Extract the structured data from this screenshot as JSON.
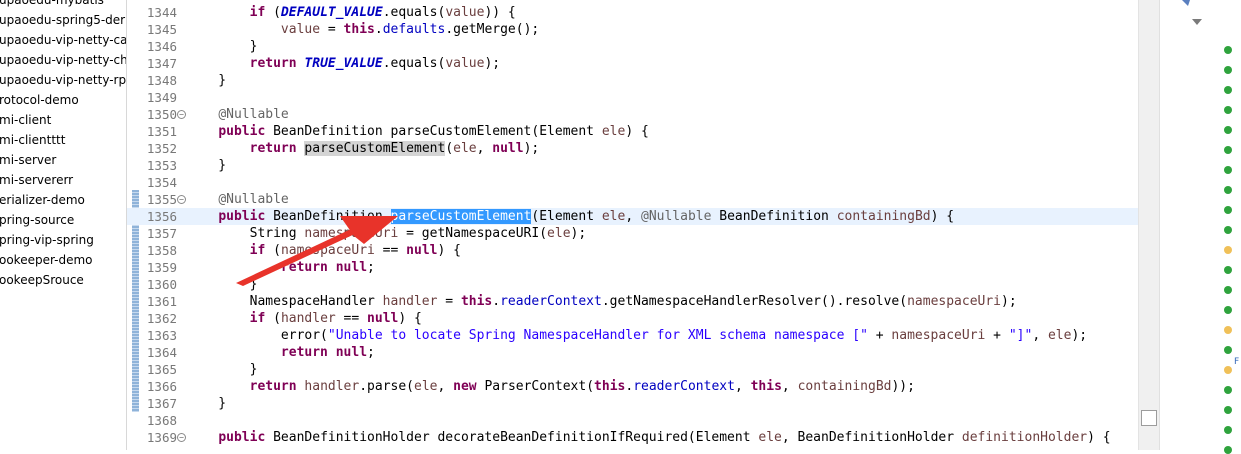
{
  "project_explorer": {
    "items": [
      "upaoedu-mybatis",
      "upaoedu-spring5-der",
      "upaoedu-vip-netty-ca",
      "upaoedu-vip-netty-ch",
      "upaoedu-vip-netty-rp",
      "rotocol-demo",
      "mi-client",
      "mi-clientttt",
      "mi-server",
      "mi-servererr",
      "erializer-demo",
      "pring-source",
      "pring-vip-spring",
      "ookeeper-demo",
      "ookeepSrouce"
    ]
  },
  "editor": {
    "current_line": "1356",
    "selected_word": "parseCustomElement",
    "lines": [
      {
        "n": "1344",
        "code": "        if (DEFAULT_VALUE.equals(value)) {"
      },
      {
        "n": "1345",
        "code": "            value = this.defaults.getMerge();"
      },
      {
        "n": "1346",
        "code": "        }"
      },
      {
        "n": "1347",
        "code": "        return TRUE_VALUE.equals(value);"
      },
      {
        "n": "1348",
        "code": "    }"
      },
      {
        "n": "1349",
        "code": ""
      },
      {
        "n": "1350",
        "code": "    @Nullable"
      },
      {
        "n": "1351",
        "code": "    public BeanDefinition parseCustomElement(Element ele) {"
      },
      {
        "n": "1352",
        "code": "        return parseCustomElement(ele, null);"
      },
      {
        "n": "1353",
        "code": "    }"
      },
      {
        "n": "1354",
        "code": ""
      },
      {
        "n": "1355",
        "code": "    @Nullable"
      },
      {
        "n": "1356",
        "code": "    public BeanDefinition parseCustomElement(Element ele, @Nullable BeanDefinition containingBd) {"
      },
      {
        "n": "1357",
        "code": "        String namespaceUri = getNamespaceURI(ele);"
      },
      {
        "n": "1358",
        "code": "        if (namespaceUri == null) {"
      },
      {
        "n": "1359",
        "code": "            return null;"
      },
      {
        "n": "1360",
        "code": "        }"
      },
      {
        "n": "1361",
        "code": "        NamespaceHandler handler = this.readerContext.getNamespaceHandlerResolver().resolve(namespaceUri);"
      },
      {
        "n": "1362",
        "code": "        if (handler == null) {"
      },
      {
        "n": "1363",
        "code": "            error(\"Unable to locate Spring NamespaceHandler for XML schema namespace [\" + namespaceUri + \"]\", ele);"
      },
      {
        "n": "1364",
        "code": "            return null;"
      },
      {
        "n": "1365",
        "code": "        }"
      },
      {
        "n": "1366",
        "code": "        return handler.parse(ele, new ParserContext(this.readerContext, this, containingBd));"
      },
      {
        "n": "1367",
        "code": "    }"
      },
      {
        "n": "1368",
        "code": ""
      },
      {
        "n": "1369",
        "code": "    public BeanDefinitionHolder decorateBeanDefinitionIfRequired(Element ele, BeanDefinitionHolder definitionHolder) {"
      }
    ]
  },
  "outline": {
    "label": "F"
  },
  "colors": {
    "keyword": "#7f0055",
    "annotation": "#646464",
    "field": "#0000c0",
    "string": "#2a00ff",
    "selection": "#3399ff",
    "current_line": "#e8f2fe",
    "arrow": "#e8332a"
  }
}
